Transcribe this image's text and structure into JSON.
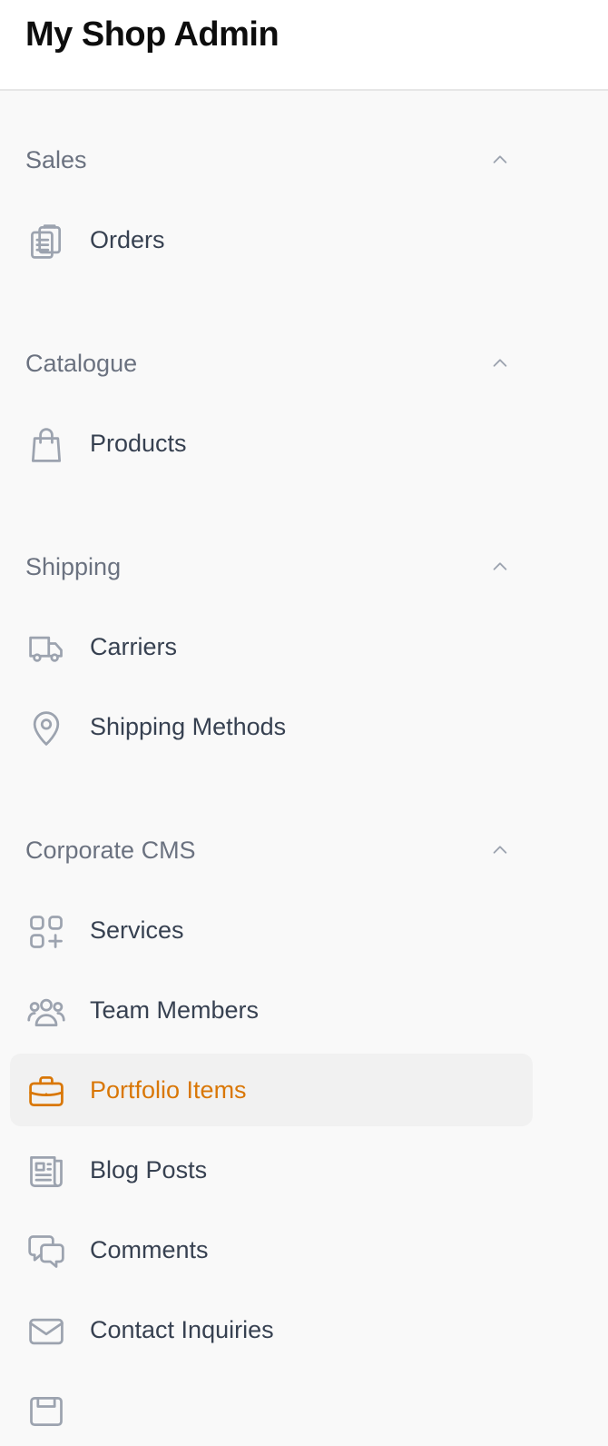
{
  "header": {
    "title": "My Shop Admin"
  },
  "colors": {
    "active_accent": "#d97706",
    "text": "#374151",
    "group_label": "#6b7280",
    "icon": "#9ca3af",
    "active_bg": "#f1f1f1"
  },
  "sidebar": {
    "groups": [
      {
        "label": "Sales",
        "expanded": true,
        "items": [
          {
            "label": "Orders",
            "icon": "clipboard-icon"
          }
        ]
      },
      {
        "label": "Catalogue",
        "expanded": true,
        "items": [
          {
            "label": "Products",
            "icon": "shopping-bag-icon"
          }
        ]
      },
      {
        "label": "Shipping",
        "expanded": true,
        "items": [
          {
            "label": "Carriers",
            "icon": "truck-icon"
          },
          {
            "label": "Shipping Methods",
            "icon": "map-pin-icon"
          }
        ]
      },
      {
        "label": "Corporate CMS",
        "expanded": true,
        "items": [
          {
            "label": "Services",
            "icon": "squares-plus-icon"
          },
          {
            "label": "Team Members",
            "icon": "user-group-icon"
          },
          {
            "label": "Portfolio Items",
            "icon": "briefcase-icon",
            "active": true
          },
          {
            "label": "Blog Posts",
            "icon": "newspaper-icon"
          },
          {
            "label": "Comments",
            "icon": "chat-bubbles-icon"
          },
          {
            "label": "Contact Inquiries",
            "icon": "envelope-icon"
          }
        ]
      }
    ]
  }
}
